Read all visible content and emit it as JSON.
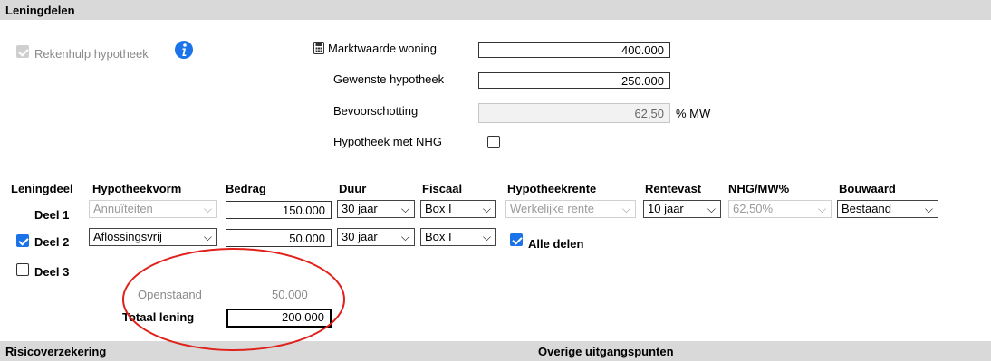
{
  "sections": {
    "leningdelen": "Leningdelen",
    "risico": "Risicoverzekering",
    "overige": "Overige uitgangspunten"
  },
  "rekenhulp": {
    "label": "Rekenhulp hypotheek",
    "checked": true,
    "disabled": true,
    "icon": "info-icon"
  },
  "fields": {
    "marktwaarde": {
      "label": "Marktwaarde woning",
      "value": "400.000",
      "icon": "calculator-icon"
    },
    "gewenste": {
      "label": "Gewenste hypotheek",
      "value": "250.000"
    },
    "bevoorschotting": {
      "label": "Bevoorschotting",
      "value": "62,50",
      "unit": "% MW"
    },
    "nhg": {
      "label": "Hypotheek met NHG",
      "checked": false
    }
  },
  "table": {
    "headers": {
      "leningdeel": "Leningdeel",
      "vorm": "Hypotheekvorm",
      "bedrag": "Bedrag",
      "duur": "Duur",
      "fiscaal": "Fiscaal",
      "rente": "Hypotheekrente",
      "rentevast": "Rentevast",
      "nhgmw": "NHG/MW%",
      "bouwaard": "Bouwaard"
    },
    "rows": [
      {
        "label": "Deel 1",
        "vorm": "Annuïteiten",
        "bedrag": "150.000",
        "duur": "30 jaar",
        "fiscaal": "Box I",
        "rente": "Werkelijke rente",
        "rentevast": "10 jaar",
        "nhgmw": "62,50%",
        "bouwaard": "Bestaand"
      },
      {
        "label": "Deel 2",
        "checked": true,
        "vorm": "Aflossingsvrij",
        "bedrag": "50.000",
        "duur": "30 jaar",
        "fiscaal": "Box I",
        "alle_delen": "Alle delen"
      },
      {
        "label": "Deel 3",
        "checked": false
      }
    ]
  },
  "totals": {
    "openstaand_label": "Openstaand",
    "openstaand_value": "50.000",
    "totaal_label": "Totaal lening",
    "totaal_value": "200.000"
  },
  "annotation_color": "#e0201b"
}
